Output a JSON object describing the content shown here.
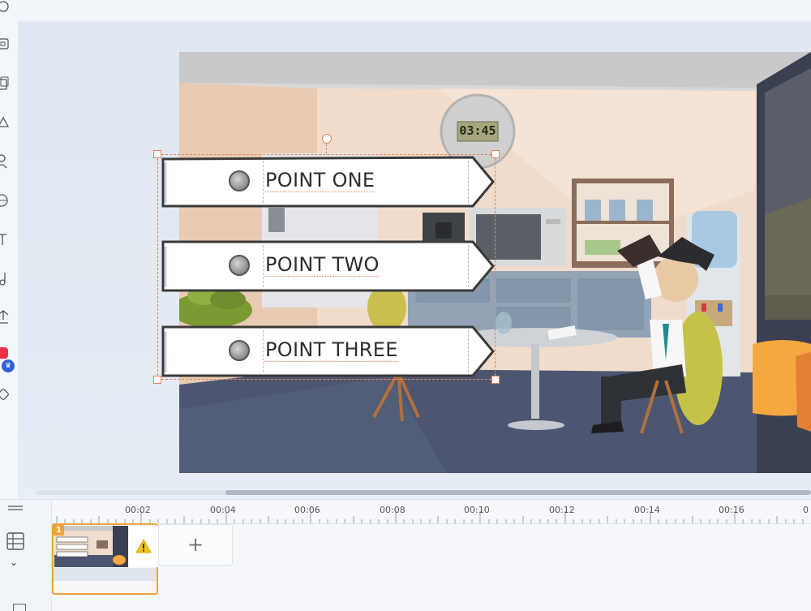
{
  "scene": {
    "clock_time": "03:45",
    "banners": [
      {
        "label": "POINT ONE"
      },
      {
        "label": "POINT TWO"
      },
      {
        "label": "POINT THREE"
      }
    ]
  },
  "timeline": {
    "ticks": [
      "00:02",
      "00:04",
      "00:06",
      "00:08",
      "00:10",
      "00:12",
      "00:14",
      "00:16",
      "0"
    ],
    "scene_number": "1",
    "add_scene_label": "+"
  },
  "toolbar": {
    "icons": [
      "refresh-icon",
      "layout-icon",
      "copy-icon",
      "shapes-icon",
      "character-icon",
      "globe-icon",
      "text-icon",
      "music-icon",
      "upload-icon",
      "premium-icon",
      "magic-icon"
    ]
  },
  "colors": {
    "selection": "#e6855a",
    "scene_accent": "#f0a23a",
    "premium": "#e8304a"
  }
}
